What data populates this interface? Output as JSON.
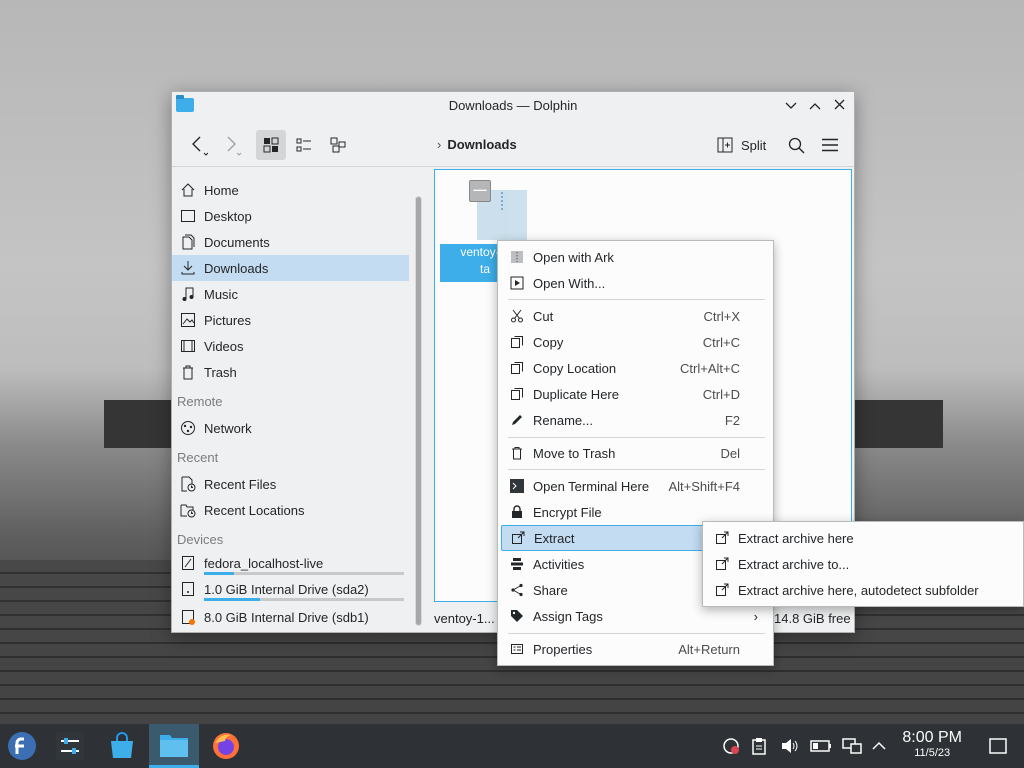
{
  "window": {
    "title": "Downloads — Dolphin"
  },
  "toolbar": {
    "breadcrumb": "Downloads",
    "split_label": "Split"
  },
  "sidebar": {
    "places": [
      {
        "label": "Home",
        "icon": "home-icon"
      },
      {
        "label": "Desktop",
        "icon": "desktop-icon"
      },
      {
        "label": "Documents",
        "icon": "documents-icon"
      },
      {
        "label": "Downloads",
        "icon": "download-icon"
      },
      {
        "label": "Music",
        "icon": "music-icon"
      },
      {
        "label": "Pictures",
        "icon": "pictures-icon"
      },
      {
        "label": "Videos",
        "icon": "videos-icon"
      },
      {
        "label": "Trash",
        "icon": "trash-icon"
      }
    ],
    "remote_heading": "Remote",
    "network": "Network",
    "recent_heading": "Recent",
    "recent_files": "Recent Files",
    "recent_locations": "Recent Locations",
    "devices_heading": "Devices",
    "devices": [
      {
        "label": "fedora_localhost-live",
        "usage": 0.15
      },
      {
        "label": "1.0 GiB Internal Drive (sda2)",
        "usage": 0.28
      },
      {
        "label": "8.0 GiB Internal Drive (sdb1)",
        "usage": 0
      }
    ]
  },
  "file": {
    "name_line1": "ventoy-1.",
    "name_line2": "ta"
  },
  "status": {
    "selection": "ventoy-1...",
    "free": "14.8 GiB free"
  },
  "context_menu": {
    "items": [
      {
        "label": "Open with Ark",
        "shortcut": "",
        "icon": "ark-icon"
      },
      {
        "label": "Open With...",
        "shortcut": "",
        "icon": "open-with-icon"
      },
      {
        "label": "Cut",
        "shortcut": "Ctrl+X",
        "icon": "scissors-icon"
      },
      {
        "label": "Copy",
        "shortcut": "Ctrl+C",
        "icon": "copy-icon"
      },
      {
        "label": "Copy Location",
        "shortcut": "Ctrl+Alt+C",
        "icon": "copy-location-icon"
      },
      {
        "label": "Duplicate Here",
        "shortcut": "Ctrl+D",
        "icon": "duplicate-icon"
      },
      {
        "label": "Rename...",
        "shortcut": "F2",
        "icon": "rename-icon"
      },
      {
        "label": "Move to Trash",
        "shortcut": "Del",
        "icon": "trash-icon"
      },
      {
        "label": "Open Terminal Here",
        "shortcut": "Alt+Shift+F4",
        "icon": "terminal-icon"
      },
      {
        "label": "Encrypt File",
        "shortcut": "",
        "icon": "lock-icon"
      },
      {
        "label": "Extract",
        "shortcut": "",
        "icon": "extract-icon"
      },
      {
        "label": "Activities",
        "shortcut": "",
        "icon": "activities-icon"
      },
      {
        "label": "Share",
        "shortcut": "",
        "icon": "share-icon"
      },
      {
        "label": "Assign Tags",
        "shortcut": "",
        "icon": "tag-icon"
      },
      {
        "label": "Properties",
        "shortcut": "Alt+Return",
        "icon": "properties-icon"
      }
    ]
  },
  "submenu": {
    "items": [
      {
        "label": "Extract archive here"
      },
      {
        "label": "Extract archive to..."
      },
      {
        "label": "Extract archive here, autodetect subfolder"
      }
    ]
  },
  "taskbar": {
    "time": "8:00 PM",
    "date": "11/5/23"
  },
  "colors": {
    "accent": "#3daee9",
    "selection": "#c3dcf1",
    "taskbar": "#2e3236"
  }
}
